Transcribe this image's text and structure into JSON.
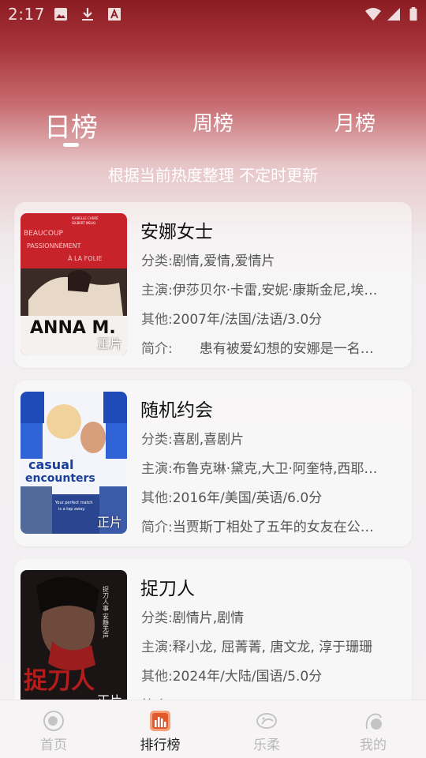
{
  "status_bar": {
    "time": "2:17",
    "icons": [
      "image-icon",
      "download-icon",
      "font-icon",
      "wifi-icon",
      "signal-icon",
      "battery-icon"
    ]
  },
  "tabs": [
    {
      "label": "日榜",
      "active": true
    },
    {
      "label": "周榜",
      "active": false
    },
    {
      "label": "月榜",
      "active": false
    }
  ],
  "subtitle": "根据当前热度整理 不定时更新",
  "field_labels": {
    "genre": "分类:",
    "cast": "主演:",
    "other": "其他:",
    "intro": "简介:"
  },
  "movies": [
    {
      "title": "安娜女士",
      "genre": "剧情,爱情,爱情片",
      "cast": "伊莎贝尔·卡雷,安妮·康斯金尼,埃…",
      "other": "2007年/法国/法语/3.0分",
      "intro": "　　患有被爱幻想的安娜是一名…",
      "badge": "正片",
      "poster_text": {
        "l1": "ISABELLE CARRÉ",
        "l2": "GILBERT MELKI",
        "l3": "BEAUCOUP",
        "l4": "PASSIONNÉMENT",
        "l5": "À LA FOLIE",
        "title": "ANNA M."
      }
    },
    {
      "title": "随机约会",
      "genre": "喜剧,喜剧片",
      "cast": "布鲁克琳·黛克,大卫·阿奎特,西耶…",
      "other": "2016年/美国/英语/6.0分",
      "intro": "当贾斯丁相处了五年的女友在公…",
      "badge": "正片",
      "poster_text": {
        "l1": "casual",
        "l2": "encounters",
        "l3": "Your perfect match",
        "l4": "is a tap away."
      }
    },
    {
      "title": "捉刀人",
      "genre": "剧情片,剧情",
      "cast": "释小龙, 屈菁菁, 唐文龙, 淳于珊珊",
      "other": "2024年/大陆/国语/5.0分",
      "intro": "",
      "badge": "正片",
      "poster_text": {
        "l1": "捉刀人",
        "l2": "捉刀人事 安静无声"
      }
    }
  ],
  "bottom_nav": [
    {
      "label": "首页",
      "icon": "home-icon",
      "active": false
    },
    {
      "label": "排行榜",
      "icon": "ranking-icon",
      "active": true
    },
    {
      "label": "乐柔",
      "icon": "fish-icon",
      "active": false
    },
    {
      "label": "我的",
      "icon": "profile-icon",
      "active": false
    }
  ],
  "colors": {
    "header_red": "#8c1c22",
    "accent_orange": "#e05a2b",
    "inactive_gray": "#b8b8b8"
  }
}
